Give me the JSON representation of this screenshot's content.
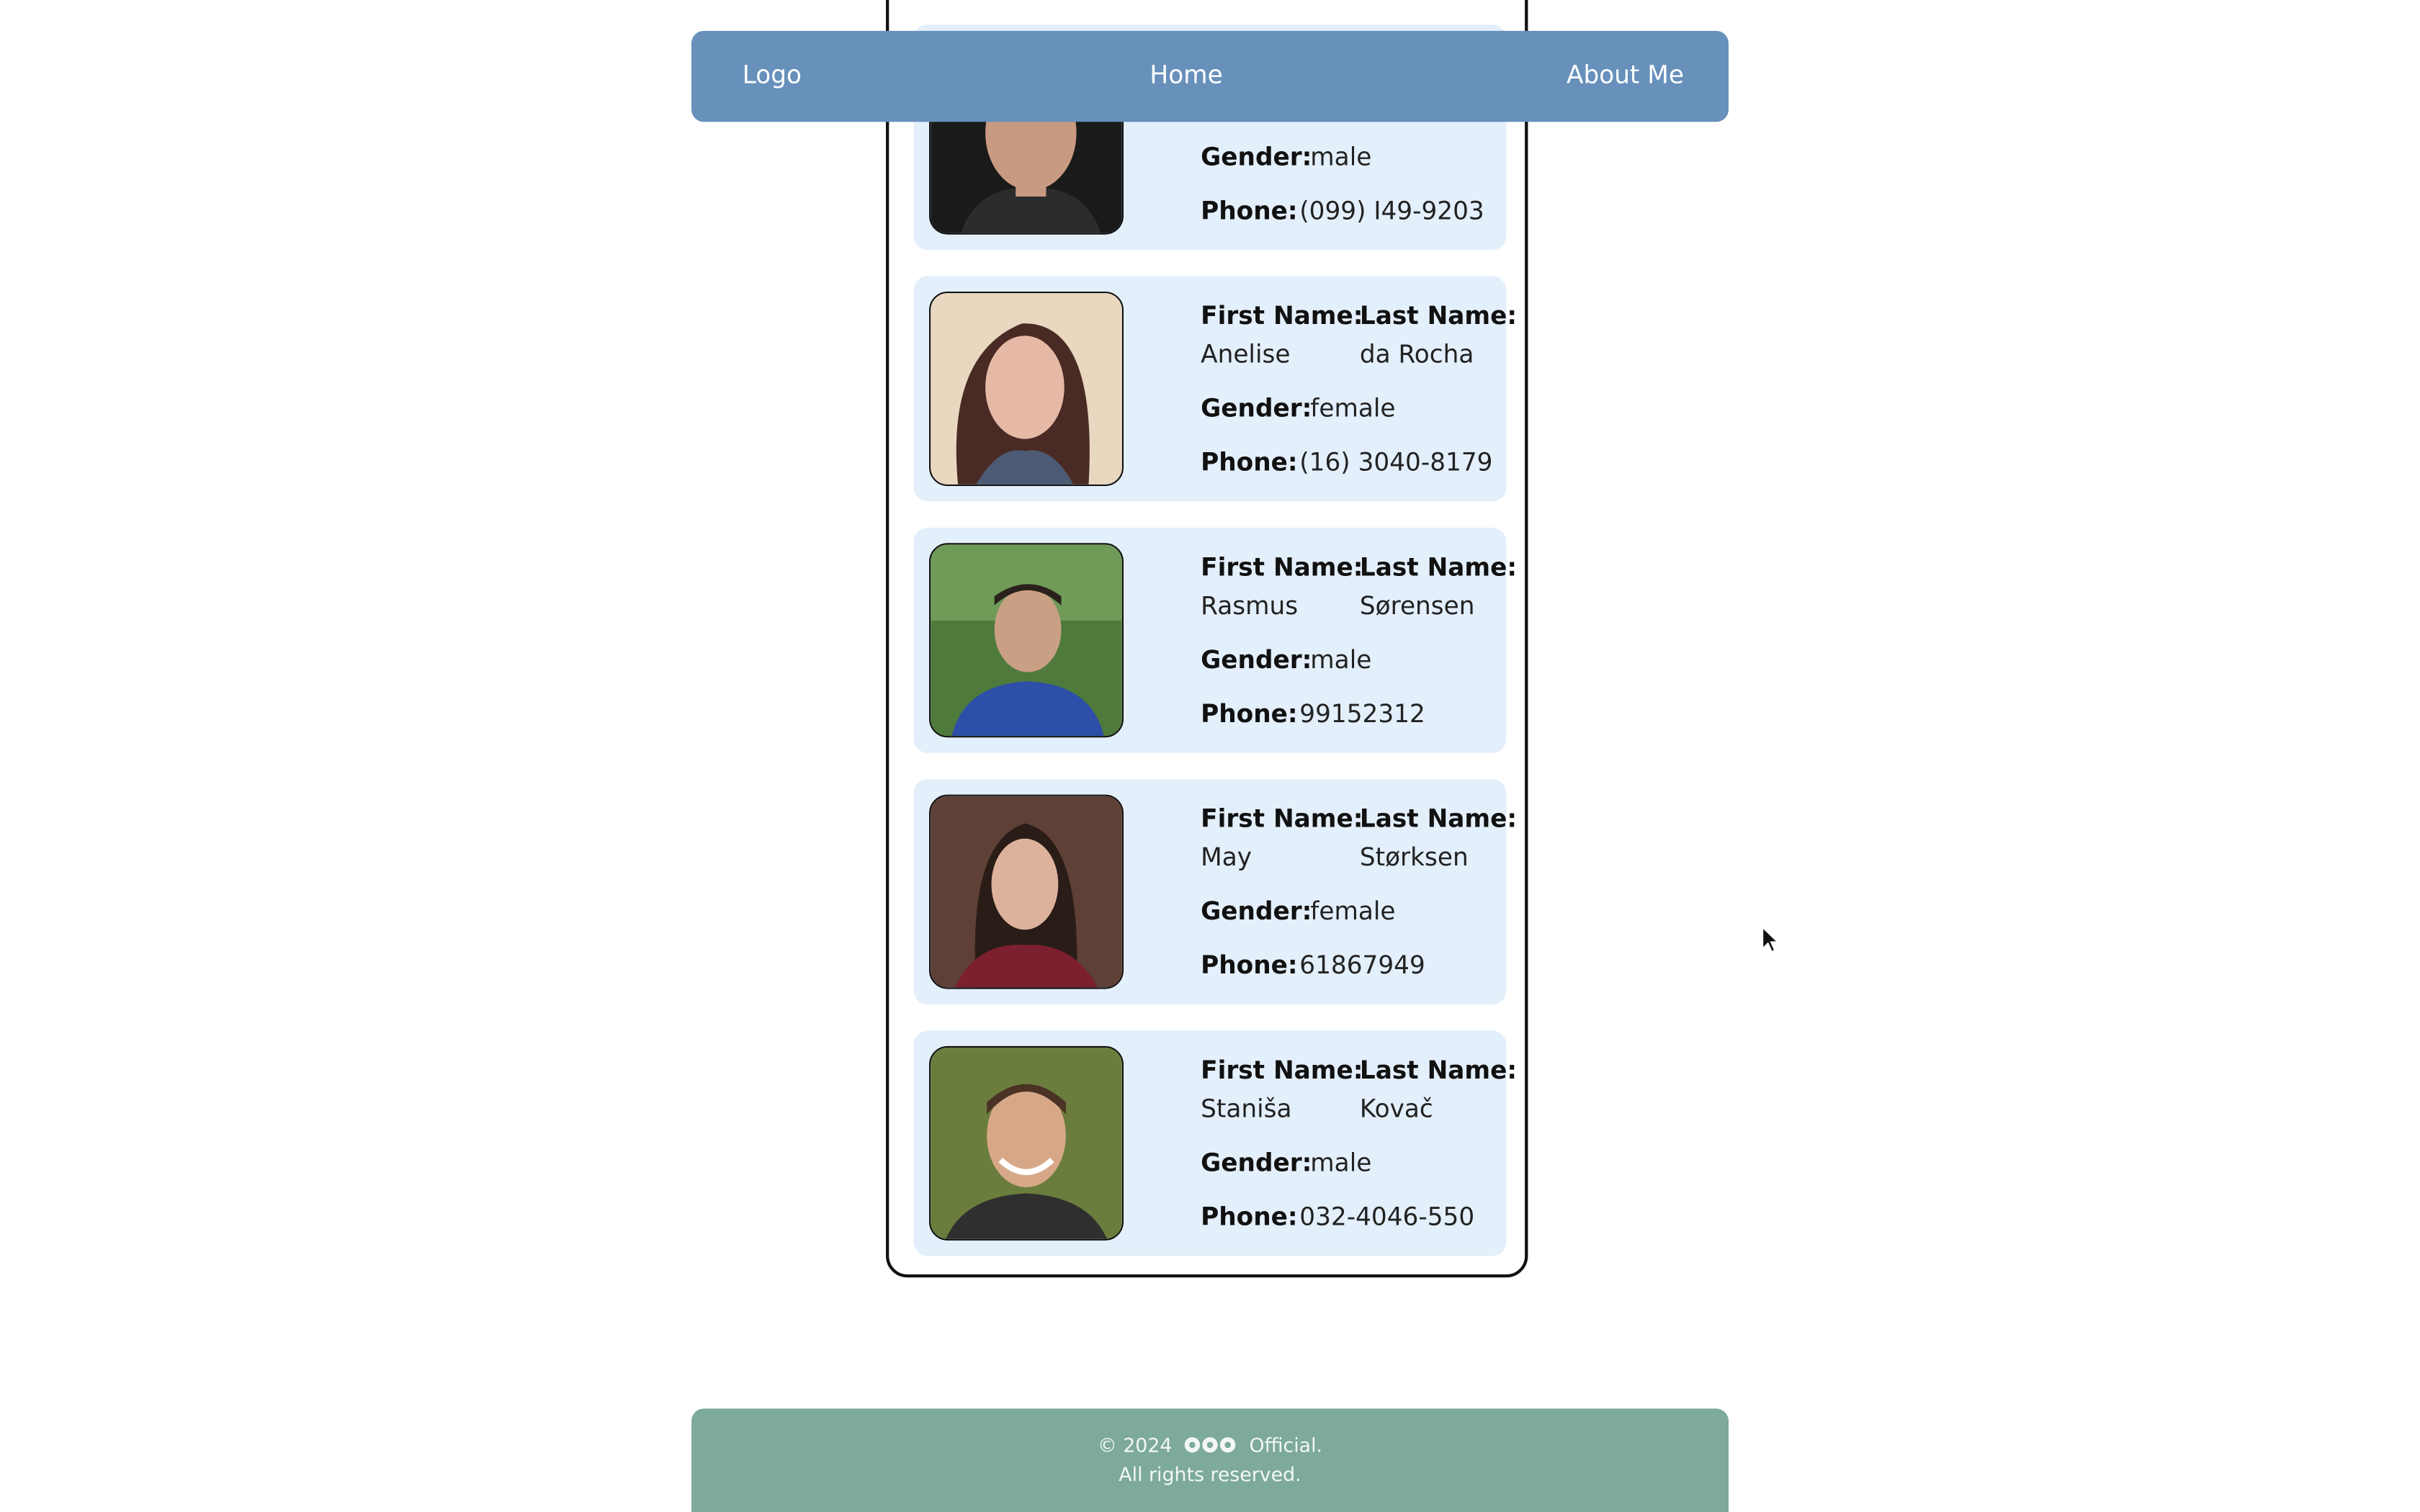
{
  "nav": {
    "logo": "Logo",
    "home": "Home",
    "about": "About Me"
  },
  "labels": {
    "first_name": "First Name:",
    "last_name": "Last Name:",
    "gender": "Gender:",
    "phone": "Phone:"
  },
  "people": [
    {
      "gender": "male",
      "phone": "(099) I49-9203"
    },
    {
      "first": "Anelise",
      "last": "da Rocha",
      "gender": "female",
      "phone": "(16) 3040-8179"
    },
    {
      "first": "Rasmus",
      "last": "Sørensen",
      "gender": "male",
      "phone": "99152312"
    },
    {
      "first": "May",
      "last": "Størksen",
      "gender": "female",
      "phone": "61867949"
    },
    {
      "first": "Staniša",
      "last": "Kovač",
      "gender": "male",
      "phone": "032-4046-550"
    }
  ],
  "footer": {
    "copyright": "© 2024",
    "brand_suffix": "Official.",
    "rights": "All rights reserved."
  },
  "colors": {
    "navbar": "#6790bb",
    "card": "#e3effb",
    "footer": "#7daa99"
  }
}
